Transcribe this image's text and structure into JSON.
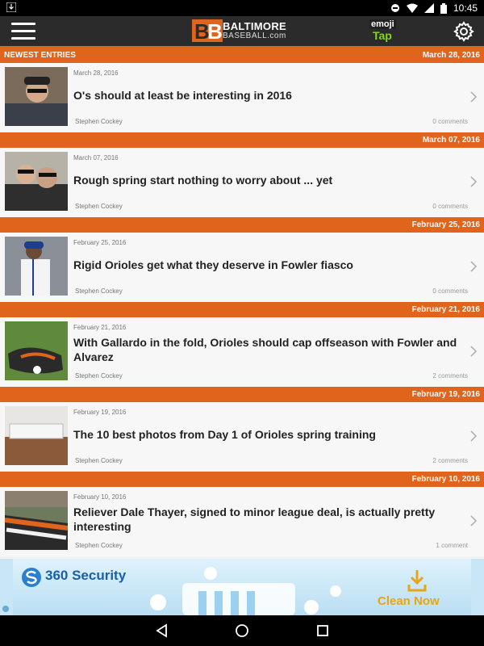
{
  "status": {
    "time": "10:45"
  },
  "header": {
    "logo_line1": "BALTIMORE",
    "logo_line2": "BASEBALL.com",
    "promo_line1": "emoji",
    "promo_line2": "Tap"
  },
  "section_label": "NEWEST ENTRIES",
  "entries": [
    {
      "header_date": "March 28, 2016",
      "date": "March 28, 2016",
      "title": "O's should at least be interesting in 2016",
      "author": "Stephen Cockey",
      "comments": "0 comments"
    },
    {
      "header_date": "March 07, 2016",
      "date": "March 07, 2016",
      "title": "Rough spring start nothing to worry about ... yet",
      "author": "Stephen Cockey",
      "comments": "0 comments"
    },
    {
      "header_date": "February 25, 2016",
      "date": "February 25, 2016",
      "title": "Rigid Orioles get what they deserve in Fowler fiasco",
      "author": "Stephen Cockey",
      "comments": "0 comments"
    },
    {
      "header_date": "February 21, 2016",
      "date": "February 21, 2016",
      "title": "With Gallardo in the fold, Orioles should cap offseason with Fowler and Alvarez",
      "author": "Stephen Cockey",
      "comments": "2 comments"
    },
    {
      "header_date": "February 19, 2016",
      "date": "February 19, 2016",
      "title": "The 10 best photos from Day 1 of Orioles spring training",
      "author": "Stephen Cockey",
      "comments": "2 comments"
    },
    {
      "header_date": "February 10, 2016",
      "date": "February 10, 2016",
      "title": "Reliever Dale Thayer, signed to minor league deal, is actually pretty interesting",
      "author": "Stephen Cockey",
      "comments": "1 comment"
    }
  ],
  "ad": {
    "brand": "360 Security",
    "cta": "Clean Now"
  },
  "colors": {
    "accent": "#e1641c",
    "appbar": "#2b2b2b"
  }
}
